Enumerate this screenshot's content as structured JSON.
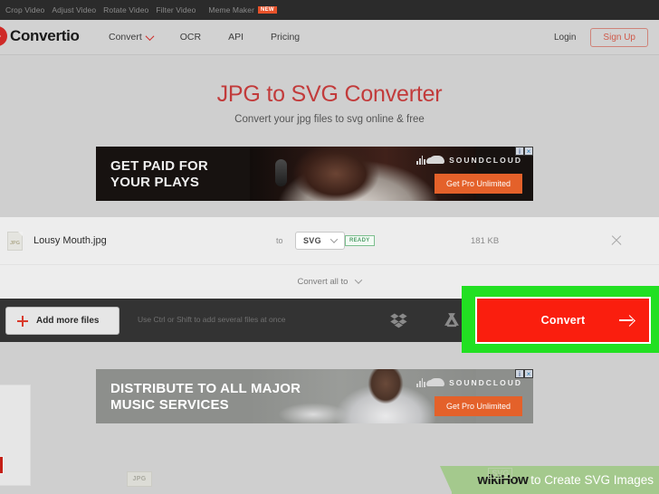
{
  "topbar": {
    "items": [
      {
        "label": "Crop Video"
      },
      {
        "label": "Adjust Video"
      },
      {
        "label": "Rotate Video"
      },
      {
        "label": "Filter Video"
      },
      {
        "label": "Meme Maker",
        "badge": "NEW"
      }
    ]
  },
  "header": {
    "logo_text": "Convertio",
    "nav": [
      {
        "label": "Convert",
        "has_caret": true
      },
      {
        "label": "OCR",
        "has_caret": false
      },
      {
        "label": "API",
        "has_caret": false
      },
      {
        "label": "Pricing",
        "has_caret": false
      }
    ],
    "login_label": "Login",
    "signup_label": "Sign Up",
    "accent_color": "#cf2a27"
  },
  "hero": {
    "title": "JPG to SVG Converter",
    "subtitle": "Convert your jpg files to svg online & free",
    "title_color": "#c23b3b"
  },
  "ads": [
    {
      "headline": "GET PAID FOR\nYOUR PLAYS",
      "headline_line1": "GET PAID FOR",
      "headline_line2": "YOUR PLAYS",
      "brand": "SOUNDCLOUD",
      "cta": "Get Pro Unlimited",
      "cta_color": "#e4612a",
      "background": "#171210"
    },
    {
      "headline_line1": "DISTRIBUTE TO ALL MAJOR",
      "headline_line2": "MUSIC SERVICES",
      "brand": "SOUNDCLOUD",
      "cta": "Get Pro Unlimited",
      "cta_color": "#e4612a",
      "background": "#8d8f8c"
    }
  ],
  "file_panel": {
    "file_icon_label": "JPG",
    "file_name": "Lousy Mouth.jpg",
    "to_label": "to",
    "format_value": "SVG",
    "status_badge": "READY",
    "status_color": "#4f9e68",
    "file_size": "181 KB",
    "convert_all_label": "Convert all to"
  },
  "actionbar": {
    "add_files_label": "Add more files",
    "hint": "Use Ctrl or Shift to add several files at once",
    "dropbox_icon": "dropbox-icon",
    "gdrive_icon": "google-drive-icon",
    "convert_label": "Convert",
    "convert_color": "#fa1e0e",
    "highlight_color": "#22e022"
  },
  "bottom": {
    "jpg_chip": "JPG"
  },
  "watermark": {
    "wiki": "wikiHow",
    "rest": "to Create SVG Images",
    "ghost_badge": "SVG",
    "background": "#a4c98d"
  }
}
